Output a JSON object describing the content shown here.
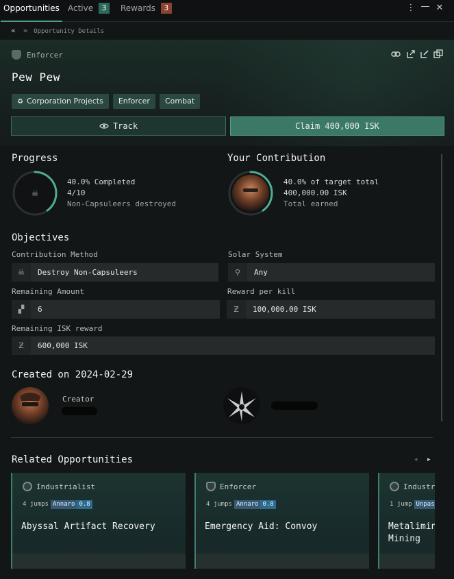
{
  "tabs": [
    {
      "label": "Opportunities",
      "badge": null
    },
    {
      "label": "Active",
      "badge": "3",
      "badge_color": "#2e6a5b"
    },
    {
      "label": "Rewards",
      "badge": "3",
      "badge_color": "#8a4231"
    }
  ],
  "breadcrumb": {
    "current": "Opportunity Details"
  },
  "header": {
    "career": "Enforcer",
    "title": "Pew Pew",
    "tags": [
      "Corporation Projects",
      "Enforcer",
      "Combat"
    ],
    "track_label": "Track",
    "claim_label": "Claim 400,000 ISK"
  },
  "progress": {
    "heading": "Progress",
    "fraction": 0.4,
    "completed": "40.0% Completed",
    "count": "4/10",
    "desc": "Non-Capsuleers destroyed"
  },
  "contribution": {
    "heading": "Your Contribution",
    "fraction": 0.4,
    "percent": "40.0% of target total",
    "amount": "400,000.00 ISK",
    "desc": "Total earned"
  },
  "objectives": {
    "heading": "Objectives",
    "method_label": "Contribution Method",
    "method_value": "Destroy Non-Capsuleers",
    "system_label": "Solar System",
    "system_value": "Any",
    "remaining_label": "Remaining Amount",
    "remaining_value": "6",
    "reward_label": "Reward per kill",
    "reward_value": "100,000.00 ISK",
    "isk_label": "Remaining ISK reward",
    "isk_value": "600,000 ISK"
  },
  "created": {
    "heading": "Created on 2024-02-29",
    "creator_label": "Creator"
  },
  "related": {
    "heading": "Related Opportunities",
    "cards": [
      {
        "category": "Industrialist",
        "jumps": "4 jumps",
        "system": "Annaro",
        "security": "0.8",
        "title_lines": [
          "Abyssal Artifact Recovery"
        ]
      },
      {
        "category": "Enforcer",
        "jumps": "4 jumps",
        "system": "Annaro",
        "security": "0.8",
        "title_lines": [
          "Emergency Aid: Convoy"
        ]
      },
      {
        "category": "Industrial",
        "jumps": "1 jump",
        "system": "Unpas",
        "security": "",
        "title_lines": [
          "Metalimin",
          "Mining"
        ]
      }
    ]
  },
  "colors": {
    "accent": "#4e9e86",
    "claim": "#3b7966"
  }
}
